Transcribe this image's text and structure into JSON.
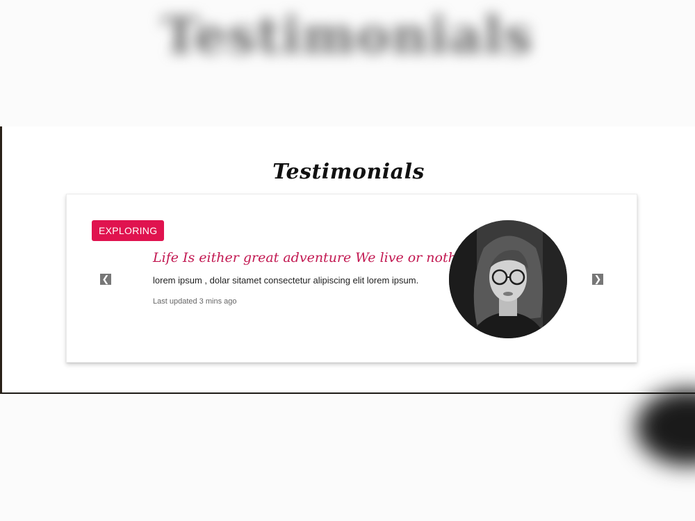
{
  "background_heading": "Testimonials",
  "section": {
    "title": "Testimonials"
  },
  "testimonial": {
    "badge": "EXPLORING",
    "quote": "Life Is either great adventure We live or nothing .",
    "description": "lorem ipsum , dolar sitamet consectetur alipiscing elit lorem ipsum.",
    "updated": "Last updated 3 mins ago",
    "avatar_alt": "portrait of a woman with glasses"
  },
  "icons": {
    "prev": "chevron-left-icon",
    "next": "chevron-right-icon"
  },
  "colors": {
    "accent": "#e0134f",
    "quote": "#c21851",
    "nav": "#777777"
  }
}
